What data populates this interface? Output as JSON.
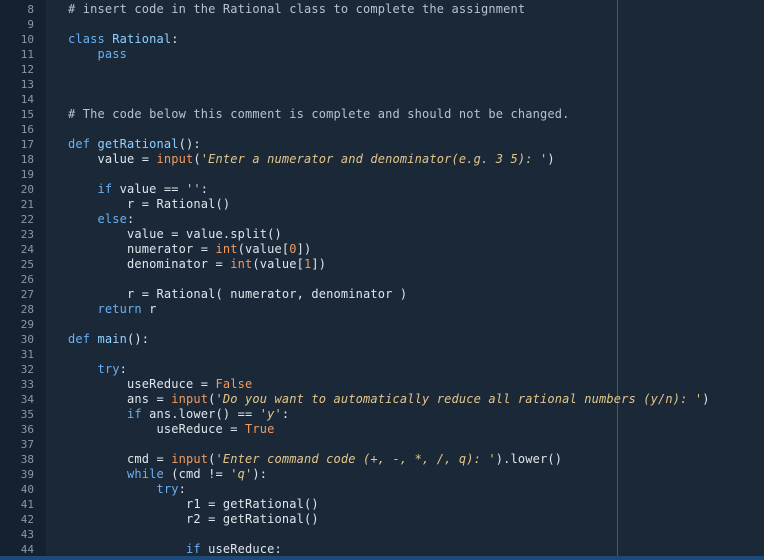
{
  "editor": {
    "language": "python",
    "colors": {
      "background": "#1b2838",
      "gutter": "#162130",
      "text": "#dfe6ec",
      "comment": "#b8c2cc",
      "keyword": "#6ab0f3",
      "function": "#8fd0ff",
      "builtin": "#f19b5e",
      "string": "#e3c78a",
      "line_number": "#8a97a4"
    },
    "lines": [
      {
        "n": "8",
        "tokens": [
          [
            "cm",
            "# insert code in the Rational class to complete the assignment"
          ]
        ]
      },
      {
        "n": "9",
        "tokens": []
      },
      {
        "n": "10",
        "tokens": [
          [
            "kw",
            "class "
          ],
          [
            "cls",
            "Rational"
          ],
          [
            "",
            ":"
          ]
        ]
      },
      {
        "n": "11",
        "tokens": [
          [
            "",
            "    "
          ],
          [
            "kw",
            "pass"
          ]
        ]
      },
      {
        "n": "12",
        "tokens": []
      },
      {
        "n": "13",
        "tokens": []
      },
      {
        "n": "14",
        "tokens": []
      },
      {
        "n": "15",
        "tokens": [
          [
            "cm",
            "# The code below this comment is complete and should not be changed."
          ]
        ]
      },
      {
        "n": "16",
        "tokens": []
      },
      {
        "n": "17",
        "tokens": [
          [
            "kw",
            "def "
          ],
          [
            "fn",
            "getRational"
          ],
          [
            "",
            "():"
          ]
        ]
      },
      {
        "n": "18",
        "tokens": [
          [
            "",
            "    value = "
          ],
          [
            "bi",
            "input"
          ],
          [
            "",
            "("
          ],
          [
            "str",
            "'Enter a numerator and denominator(e.g. 3 5): '"
          ],
          [
            "",
            ")"
          ]
        ]
      },
      {
        "n": "19",
        "tokens": []
      },
      {
        "n": "20",
        "tokens": [
          [
            "",
            "    "
          ],
          [
            "kw",
            "if"
          ],
          [
            "",
            " value == "
          ],
          [
            "str",
            "''"
          ],
          [
            "",
            ":"
          ]
        ]
      },
      {
        "n": "21",
        "tokens": [
          [
            "",
            "        r = Rational()"
          ]
        ]
      },
      {
        "n": "22",
        "tokens": [
          [
            "",
            "    "
          ],
          [
            "kw",
            "else"
          ],
          [
            "",
            ":"
          ]
        ]
      },
      {
        "n": "23",
        "tokens": [
          [
            "",
            "        value = value.split()"
          ]
        ]
      },
      {
        "n": "24",
        "tokens": [
          [
            "",
            "        numerator = "
          ],
          [
            "bi",
            "int"
          ],
          [
            "",
            "(value["
          ],
          [
            "num",
            "0"
          ],
          [
            "",
            "])"
          ]
        ]
      },
      {
        "n": "25",
        "tokens": [
          [
            "",
            "        denominator = "
          ],
          [
            "bi",
            "int"
          ],
          [
            "",
            "(value["
          ],
          [
            "num",
            "1"
          ],
          [
            "",
            "])"
          ]
        ]
      },
      {
        "n": "26",
        "tokens": []
      },
      {
        "n": "27",
        "tokens": [
          [
            "",
            "        r = Rational( numerator, denominator )"
          ]
        ]
      },
      {
        "n": "28",
        "tokens": [
          [
            "",
            "    "
          ],
          [
            "kw",
            "return"
          ],
          [
            "",
            " r"
          ]
        ]
      },
      {
        "n": "29",
        "tokens": []
      },
      {
        "n": "30",
        "tokens": [
          [
            "kw",
            "def "
          ],
          [
            "fn",
            "main"
          ],
          [
            "",
            "():"
          ]
        ]
      },
      {
        "n": "31",
        "tokens": []
      },
      {
        "n": "32",
        "tokens": [
          [
            "",
            "    "
          ],
          [
            "kw",
            "try"
          ],
          [
            "",
            ":"
          ]
        ]
      },
      {
        "n": "33",
        "tokens": [
          [
            "",
            "        useReduce = "
          ],
          [
            "bi",
            "False"
          ]
        ]
      },
      {
        "n": "34",
        "tokens": [
          [
            "",
            "        ans = "
          ],
          [
            "bi",
            "input"
          ],
          [
            "",
            "("
          ],
          [
            "str",
            "'Do you want to automatically reduce all rational numbers (y/n): '"
          ],
          [
            "",
            ")"
          ]
        ]
      },
      {
        "n": "35",
        "tokens": [
          [
            "",
            "        "
          ],
          [
            "kw",
            "if"
          ],
          [
            "",
            " ans.lower() == "
          ],
          [
            "str",
            "'y'"
          ],
          [
            "",
            ":"
          ]
        ]
      },
      {
        "n": "36",
        "tokens": [
          [
            "",
            "            useReduce = "
          ],
          [
            "bi",
            "True"
          ]
        ]
      },
      {
        "n": "37",
        "tokens": []
      },
      {
        "n": "38",
        "tokens": [
          [
            "",
            "        cmd = "
          ],
          [
            "bi",
            "input"
          ],
          [
            "",
            "("
          ],
          [
            "str",
            "'Enter command code (+, -, *, /, q): '"
          ],
          [
            "",
            ").lower()"
          ]
        ]
      },
      {
        "n": "39",
        "tokens": [
          [
            "",
            "        "
          ],
          [
            "kw",
            "while"
          ],
          [
            "",
            " (cmd != "
          ],
          [
            "str",
            "'q'"
          ],
          [
            "",
            "):"
          ]
        ]
      },
      {
        "n": "40",
        "tokens": [
          [
            "",
            "            "
          ],
          [
            "kw",
            "try"
          ],
          [
            "",
            ":"
          ]
        ]
      },
      {
        "n": "41",
        "tokens": [
          [
            "",
            "                r1 = getRational()"
          ]
        ]
      },
      {
        "n": "42",
        "tokens": [
          [
            "",
            "                r2 = getRational()"
          ]
        ]
      },
      {
        "n": "43",
        "tokens": []
      },
      {
        "n": "44",
        "tokens": [
          [
            "",
            "                "
          ],
          [
            "kw",
            "if"
          ],
          [
            "",
            " useReduce:"
          ]
        ]
      }
    ]
  }
}
